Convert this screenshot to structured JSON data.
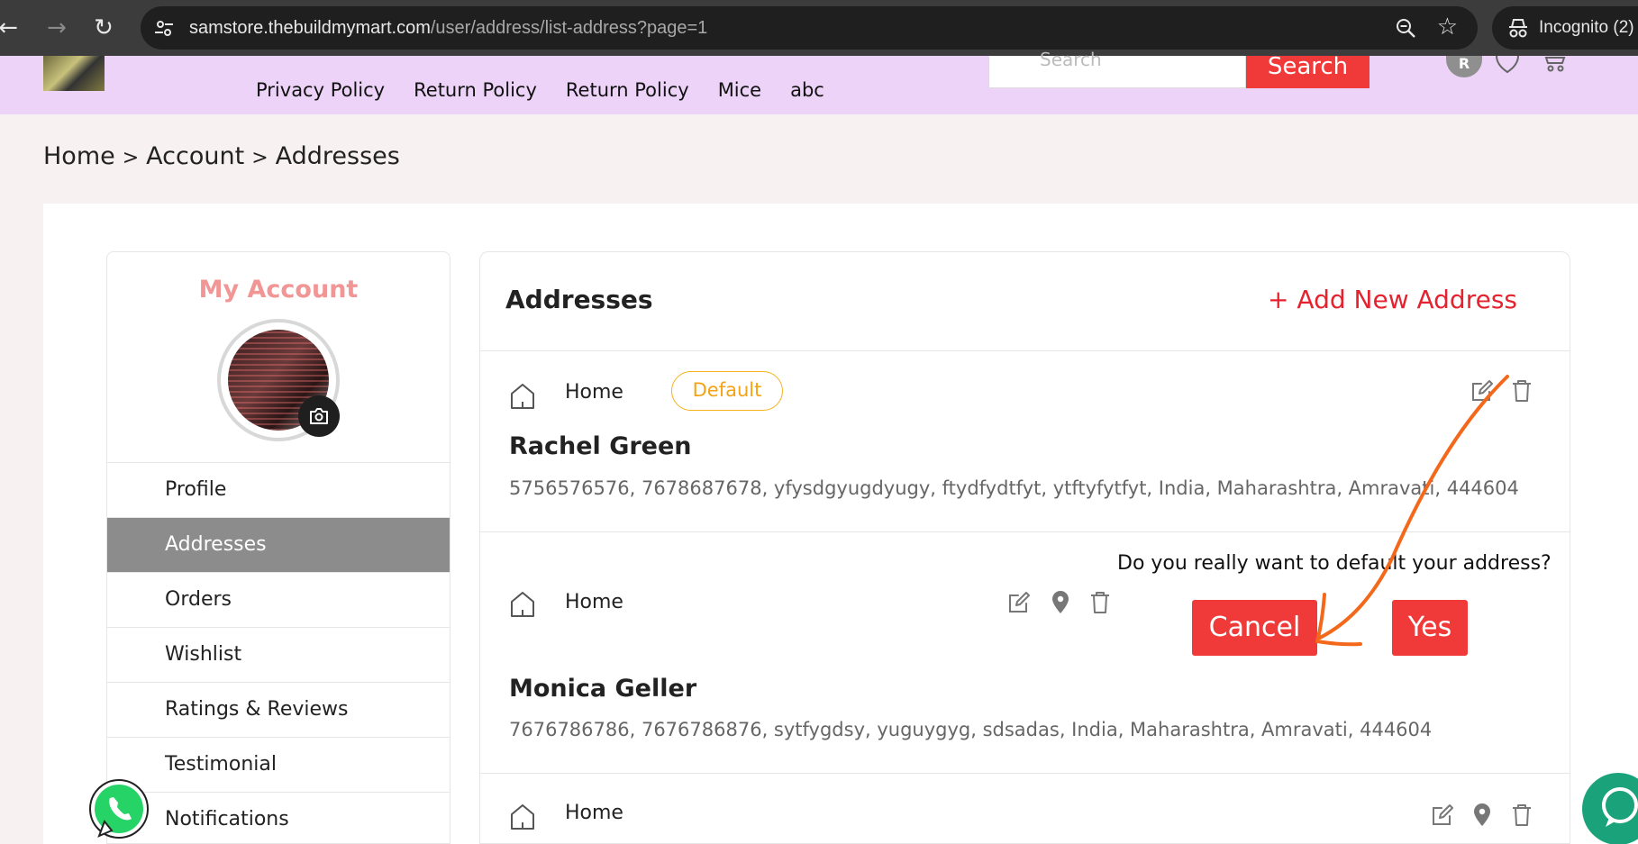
{
  "browser": {
    "url_host": "samstore.thebuildmymart.com",
    "url_path": "/user/address/list-address?page=1",
    "profile_label": "Incognito (2)"
  },
  "header": {
    "menu": [
      "Privacy Policy",
      "Return Policy",
      "Return Policy",
      "Mice",
      "abc"
    ],
    "search_placeholder": "Search",
    "search_button": "Search",
    "avatar_initial": "R"
  },
  "breadcrumb": [
    "Home",
    "Account",
    "Addresses"
  ],
  "sidebar": {
    "title": "My Account",
    "items": [
      "Profile",
      "Addresses",
      "Orders",
      "Wishlist",
      "Ratings & Reviews",
      "Testimonial",
      "Notifications"
    ],
    "active": "Addresses"
  },
  "addresses": {
    "title": "Addresses",
    "add_label": "+ Add New Address",
    "list": [
      {
        "type": "Home",
        "default_label": "Default",
        "name": "Rachel Green",
        "line": "5756576576, 7678687678, yfysdgyugdyugy, ftydfydtfyt, ytftyfytfyt, India, Maharashtra, Amravati, 444604"
      },
      {
        "type": "Home",
        "name": "Monica Geller",
        "line": "7676786786, 7676786876, sytfygdsy, yuguygyg, sdsadas, India, Maharashtra, Amravati, 444604"
      },
      {
        "type": "Home"
      }
    ]
  },
  "confirm": {
    "question": "Do you really want to default your address?",
    "cancel": "Cancel",
    "yes": "Yes"
  },
  "colors": {
    "accent": "#f03a3a",
    "header_bg": "#ecd3f7",
    "annotation_arrow": "#f4681c",
    "default_badge": "#f5a316"
  }
}
